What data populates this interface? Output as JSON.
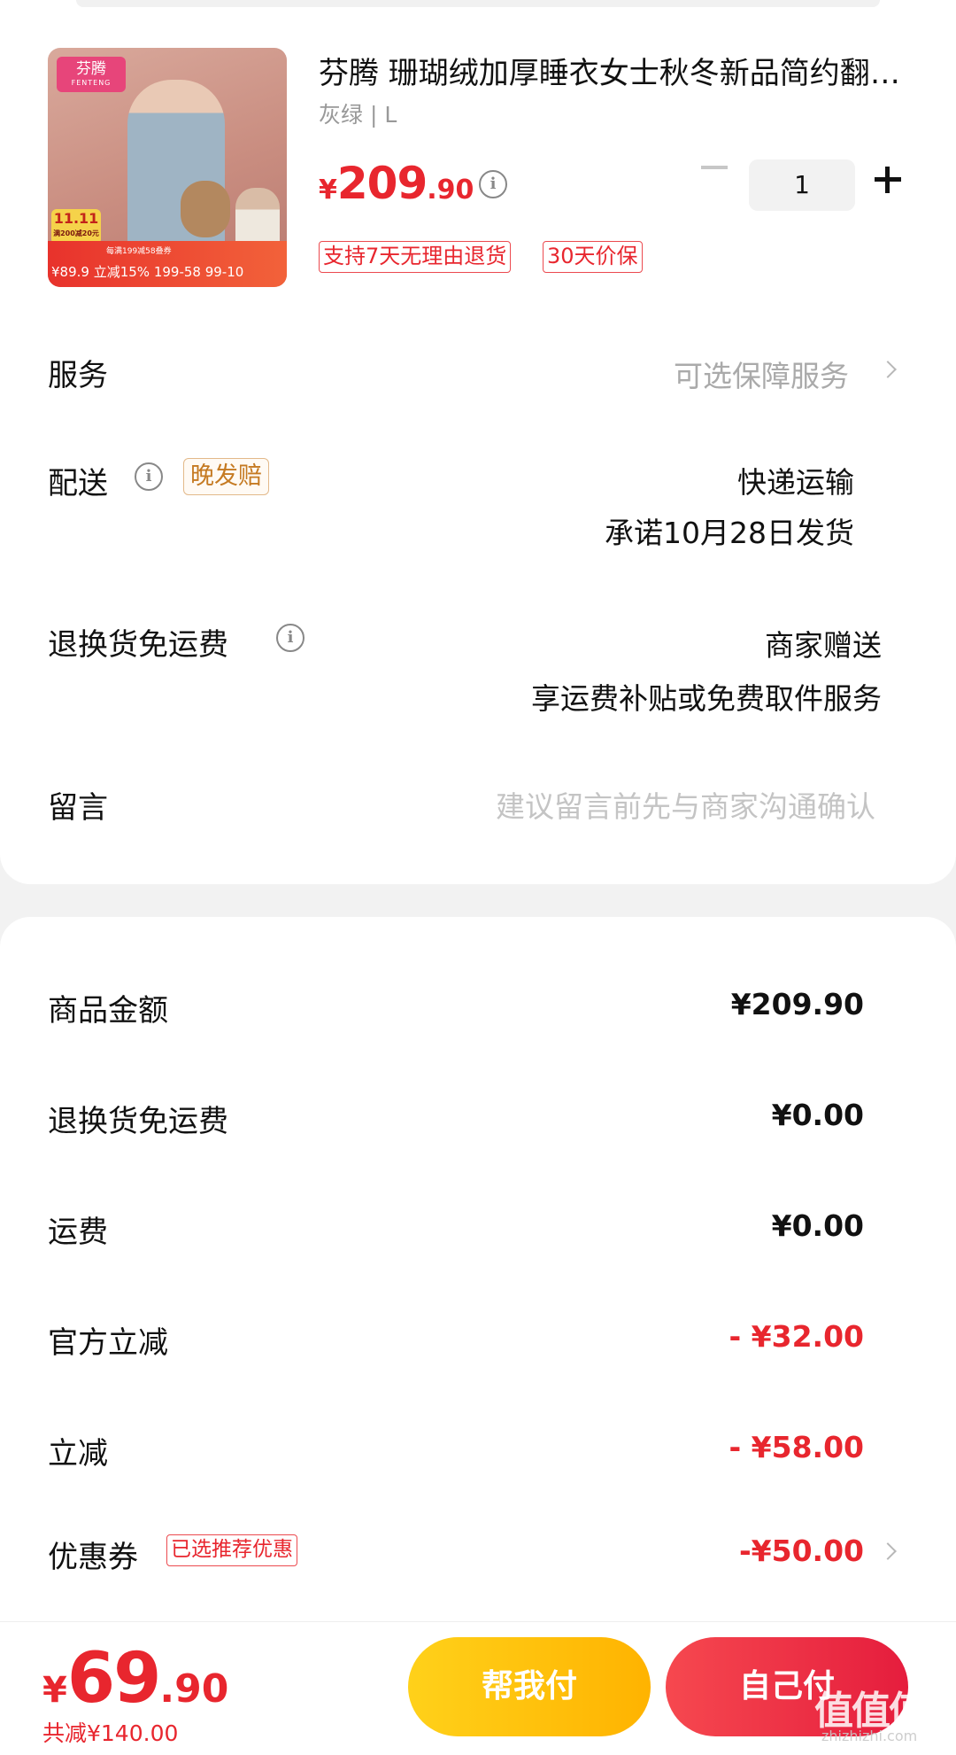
{
  "product": {
    "title": "芬腾 珊瑚绒加厚睡衣女士秋冬新品简约翻领开衫加绒家居服套装",
    "sku": "灰绿 | L",
    "price_currency": "¥",
    "price_int": "209",
    "price_dec": ".90",
    "quantity": "1",
    "tags": [
      "支持7天无理由退货",
      "30天价保"
    ],
    "image": {
      "brand": "芬腾",
      "brand_en": "FENTENG",
      "badge": "11.11",
      "badge_sub": "满200减20元",
      "promo_line1": "每满199减58叠券",
      "promo_line2": "¥89.9 立减15% 199-58 99-10"
    }
  },
  "service": {
    "label": "服务",
    "value": "可选保障服务"
  },
  "delivery": {
    "label": "配送",
    "late_tag": "晚发赔",
    "method": "快递运输",
    "promise": "承诺10月28日发货"
  },
  "return_shipping": {
    "label": "退换货免运费",
    "value1": "商家赠送",
    "value2": "享运费补贴或免费取件服务"
  },
  "message": {
    "label": "留言",
    "placeholder": "建议留言前先与商家沟通确认"
  },
  "summary": {
    "goods_label": "商品金额",
    "goods_value": "¥209.90",
    "return_label": "退换货免运费",
    "return_value": "¥0.00",
    "shipping_label": "运费",
    "shipping_value": "¥0.00",
    "official_label": "官方立减",
    "official_value": "- ¥32.00",
    "instant_label": "立减",
    "instant_value": "- ¥58.00",
    "coupon_label": "优惠券",
    "coupon_tag": "已选推荐优惠",
    "coupon_value": "-¥50.00"
  },
  "footer": {
    "currency": "¥",
    "total_int": "69",
    "total_dec": ".90",
    "saved": "共减¥140.00",
    "help_pay": "帮我付",
    "self_pay": "自己付"
  },
  "watermark": {
    "text": "值值值",
    "url": "zhizhizhi.com"
  },
  "colors": {
    "accent_red": "#e8262e",
    "help_btn": "#ffc107",
    "self_btn": "#ee3344"
  }
}
